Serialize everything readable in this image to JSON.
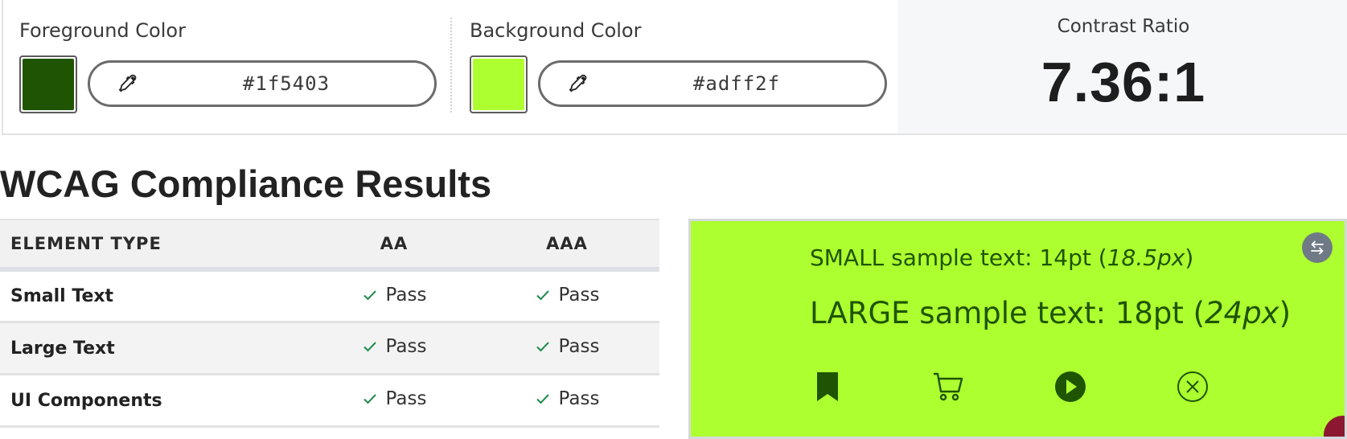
{
  "foreground": {
    "label": "Foreground Color",
    "hex": "#1f5403"
  },
  "background": {
    "label": "Background Color",
    "hex": "#adff2f"
  },
  "contrast": {
    "label": "Contrast Ratio",
    "value": "7.36:1"
  },
  "results": {
    "title": "WCAG Compliance Results",
    "headers": {
      "type": "ELEMENT TYPE",
      "aa": "AA",
      "aaa": "AAA"
    },
    "rows": [
      {
        "label": "Small Text",
        "aa": "Pass",
        "aaa": "Pass"
      },
      {
        "label": "Large Text",
        "aa": "Pass",
        "aaa": "Pass"
      },
      {
        "label": "UI Components",
        "aa": "Pass",
        "aaa": "Pass"
      }
    ]
  },
  "preview": {
    "small_prefix": "SMALL sample text: 14pt (",
    "small_px": "18.5px",
    "small_suffix": ")",
    "large_prefix": "LARGE sample text: 18pt (",
    "large_px": "24px",
    "large_suffix": ")",
    "icons": [
      "bookmark-icon",
      "cart-icon",
      "play-circle-icon",
      "close-circle-icon"
    ]
  },
  "colors": {
    "pass_check": "#1f8a4c",
    "swap_button": "#707a86"
  }
}
